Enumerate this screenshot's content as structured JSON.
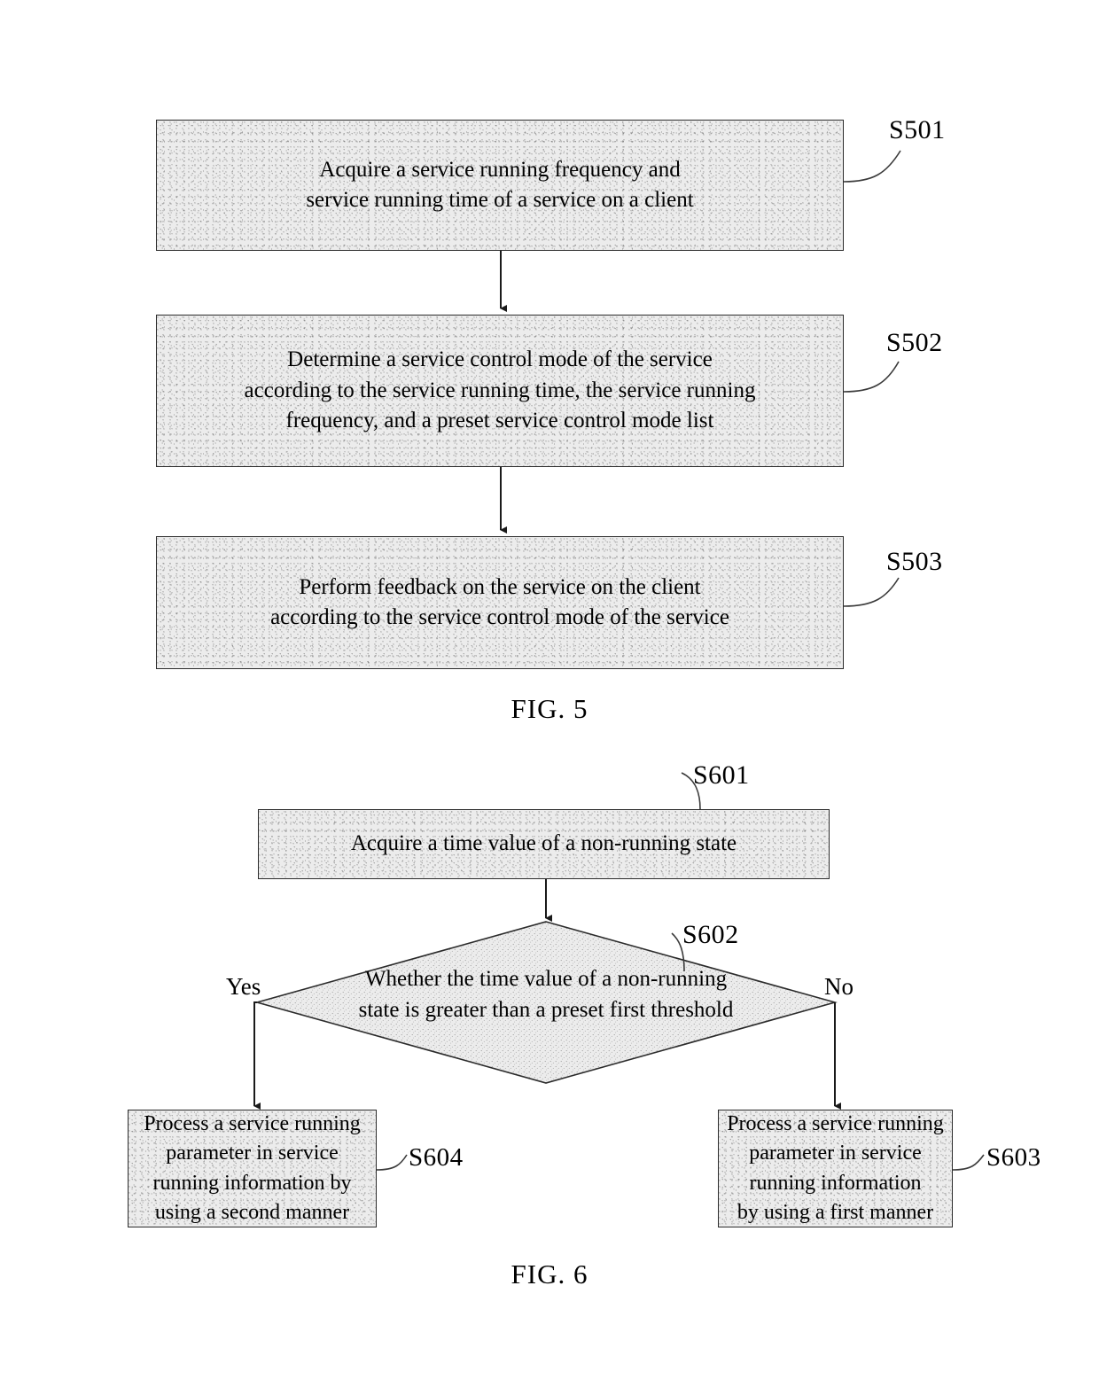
{
  "figures": [
    {
      "caption": "FIG. 5",
      "steps": [
        {
          "ref": "S501",
          "text": "Acquire a service running frequency and\nservice running time of a service on a client"
        },
        {
          "ref": "S502",
          "text": "Determine a service control mode of the service\naccording to the service running time, the service running\nfrequency, and a preset service control mode list"
        },
        {
          "ref": "S503",
          "text": "Perform feedback on the service on the client\naccording to the service control mode of the service"
        }
      ]
    },
    {
      "caption": "FIG. 6",
      "steps": [
        {
          "ref": "S601",
          "text": "Acquire a time value of a non-running state"
        },
        {
          "ref": "S602",
          "text": "Whether the time value of a non-running\nstate is greater than a preset first threshold"
        },
        {
          "ref": "S604",
          "text": "Process a service running\nparameter in service\nrunning information by\nusing a second manner"
        },
        {
          "ref": "S603",
          "text": "Process a service running\nparameter in service\nrunning information\nby using a first manner"
        }
      ],
      "branches": {
        "yes": "Yes",
        "no": "No"
      }
    }
  ],
  "colors": {
    "box_fill": "#ececec",
    "stroke": "#2b2b2b",
    "text": "#000000"
  }
}
